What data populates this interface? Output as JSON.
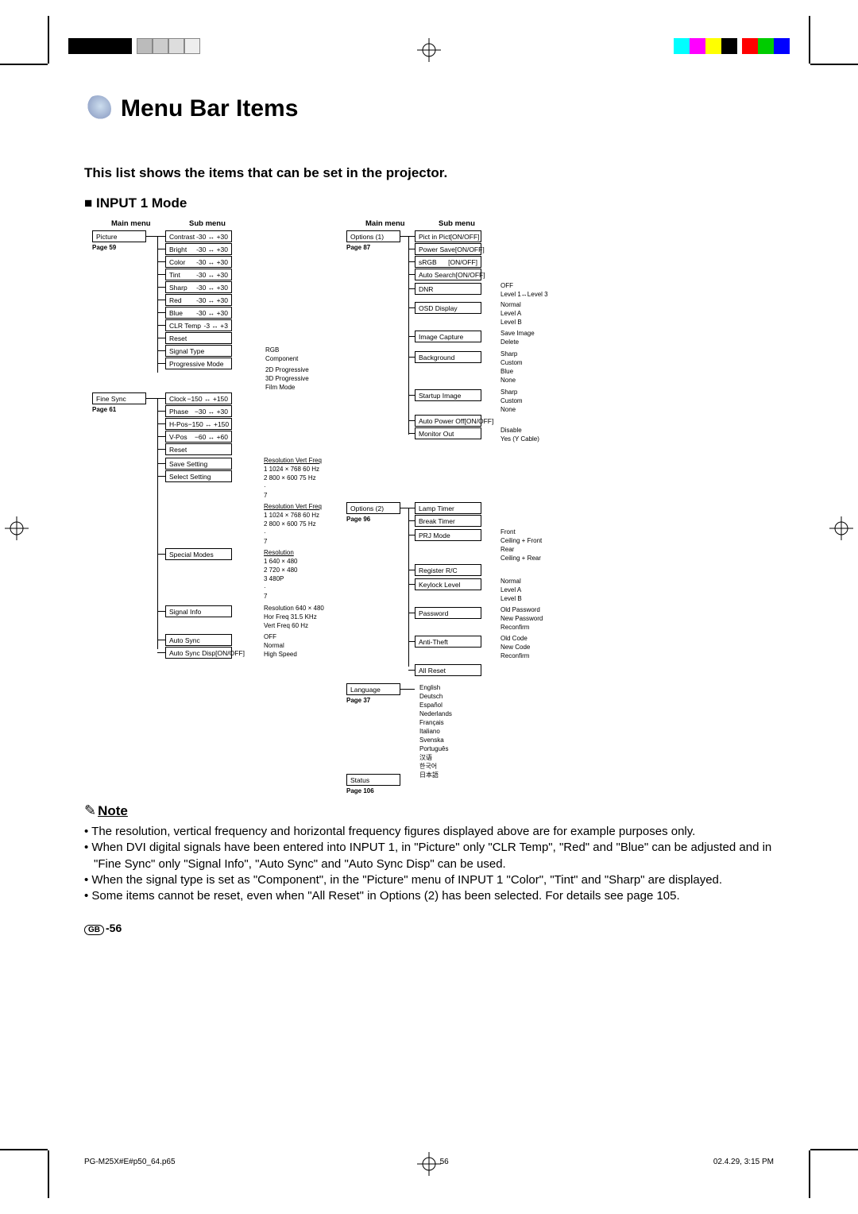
{
  "title": "Menu Bar Items",
  "subtitle": "This list shows the items that can be set in the projector.",
  "modeHead": "INPUT 1 Mode",
  "headers": {
    "main": "Main menu",
    "sub": "Sub menu"
  },
  "left": {
    "picture": {
      "label": "Picture",
      "page": "Page 59",
      "items": [
        {
          "label": "Contrast",
          "range": "-30 ↔ +30"
        },
        {
          "label": "Bright",
          "range": "-30 ↔ +30"
        },
        {
          "label": "Color",
          "range": "-30 ↔ +30"
        },
        {
          "label": "Tint",
          "range": "-30 ↔ +30"
        },
        {
          "label": "Sharp",
          "range": "-30 ↔ +30"
        },
        {
          "label": "Red",
          "range": "-30 ↔ +30"
        },
        {
          "label": "Blue",
          "range": "-30 ↔ +30"
        },
        {
          "label": "CLR Temp",
          "range": "-3 ↔ +3"
        },
        {
          "label": "Reset",
          "range": ""
        },
        {
          "label": "Signal Type",
          "range": ""
        },
        {
          "label": "Progressive Mode",
          "range": ""
        }
      ],
      "signalTypeOpts": [
        "RGB",
        "Component"
      ],
      "progOpts": [
        "2D Progressive",
        "3D Progressive",
        "Film Mode"
      ]
    },
    "finesync": {
      "label": "Fine Sync",
      "page": "Page 61",
      "items": [
        {
          "label": "Clock",
          "range": "−150 ↔ +150"
        },
        {
          "label": "Phase",
          "range": "−30 ↔ +30"
        },
        {
          "label": "H-Pos",
          "range": "−150 ↔ +150"
        },
        {
          "label": "V-Pos",
          "range": "−60 ↔ +60"
        },
        {
          "label": "Reset",
          "range": ""
        },
        {
          "label": "Save Setting",
          "range": ""
        },
        {
          "label": "Select Setting",
          "range": ""
        },
        {
          "label": "Special Modes",
          "range": ""
        },
        {
          "label": "Signal Info",
          "range": ""
        },
        {
          "label": "Auto Sync",
          "range": ""
        },
        {
          "label": "Auto Sync Disp",
          "range": "[ON/OFF]"
        }
      ],
      "saveTable": {
        "hdr": "Resolution     Vert Freq",
        "rows": [
          "1   1024 × 768    60 Hz",
          "2   800 × 600     75 Hz",
          "·",
          "7"
        ]
      },
      "selectTable": {
        "hdr": "Resolution     Vert Freq",
        "rows": [
          "1   1024 × 768    60 Hz",
          "2   800 × 600     75 Hz",
          "·",
          "7"
        ]
      },
      "specialTable": {
        "hdr": "Resolution",
        "rows": [
          "1   640 × 480",
          "2   720 × 480",
          "3   480P",
          "·",
          "7"
        ]
      },
      "signalInfo": [
        "Resolution   640 × 480",
        "Hor Freq      31.5 KHz",
        "Vert Freq    60 Hz"
      ],
      "autoSyncOpts": [
        "OFF",
        "Normal",
        "High Speed"
      ]
    }
  },
  "right": {
    "options1": {
      "label": "Options (1)",
      "page": "Page 87",
      "items": [
        {
          "label": "Pict in Pict",
          "range": "[ON/OFF]"
        },
        {
          "label": "Power Save",
          "range": "[ON/OFF]"
        },
        {
          "label": "sRGB",
          "range": "[ON/OFF]"
        },
        {
          "label": "Auto Search",
          "range": "[ON/OFF]"
        },
        {
          "label": "DNR",
          "range": ""
        },
        {
          "label": "OSD Display",
          "range": ""
        },
        {
          "label": "Image Capture",
          "range": ""
        },
        {
          "label": "Background",
          "range": ""
        },
        {
          "label": "Startup Image",
          "range": ""
        },
        {
          "label": "Auto Power Off",
          "range": "[ON/OFF]"
        },
        {
          "label": "Monitor Out",
          "range": ""
        }
      ],
      "dnr": [
        "OFF",
        "Level 1↔Level 3"
      ],
      "osd": [
        "Normal",
        "Level A",
        "Level B"
      ],
      "imgcap": [
        "Save Image",
        "Delete"
      ],
      "bg": [
        "Sharp",
        "Custom",
        "Blue",
        "None"
      ],
      "startup": [
        "Sharp",
        "Custom",
        "None"
      ],
      "monitor": [
        "Disable",
        "Yes (Y Cable)"
      ]
    },
    "options2": {
      "label": "Options (2)",
      "page": "Page 96",
      "items": [
        {
          "label": "Lamp Timer",
          "range": ""
        },
        {
          "label": "Break Timer",
          "range": ""
        },
        {
          "label": "PRJ Mode",
          "range": ""
        },
        {
          "label": "Register R/C",
          "range": ""
        },
        {
          "label": "Keylock Level",
          "range": ""
        },
        {
          "label": "Password",
          "range": ""
        },
        {
          "label": "Anti-Theft",
          "range": ""
        },
        {
          "label": "All Reset",
          "range": ""
        }
      ],
      "prj": [
        "Front",
        "Ceiling + Front",
        "Rear",
        "Ceiling + Rear"
      ],
      "keylock": [
        "Normal",
        "Level A",
        "Level B"
      ],
      "password": [
        "Old Password",
        "New Password",
        "Reconfirm"
      ],
      "antitheft": [
        "Old Code",
        "New Code",
        "Reconfirm"
      ]
    },
    "language": {
      "label": "Language",
      "page": "Page 37",
      "opts": [
        "English",
        "Deutsch",
        "Español",
        "Nederlands",
        "Français",
        "Italiano",
        "Svenska",
        "Português",
        "汉语",
        "한국어",
        "日本語"
      ]
    },
    "status": {
      "label": "Status",
      "page": "Page 106"
    }
  },
  "noteLabel": "Note",
  "notes": [
    "The resolution, vertical frequency and horizontal frequency figures displayed above are for example purposes only.",
    "When DVI digital signals have been entered into INPUT 1, in \"Picture\" only \"CLR Temp\", \"Red\" and \"Blue\" can be adjusted and in \"Fine Sync\" only \"Signal Info\", \"Auto Sync\" and \"Auto Sync Disp\" can be used.",
    "When the signal type is set as \"Component\", in the \"Picture\" menu of INPUT 1 \"Color\", \"Tint\" and \"Sharp\" are displayed.",
    "Some items cannot be reset, even when \"All Reset\" in Options (2) has been selected. For details see page 105."
  ],
  "pageNumber": "-56",
  "footer": {
    "left": "PG-M25X#E#p50_64.p65",
    "center": "56",
    "right": "02.4.29, 3:15 PM"
  }
}
